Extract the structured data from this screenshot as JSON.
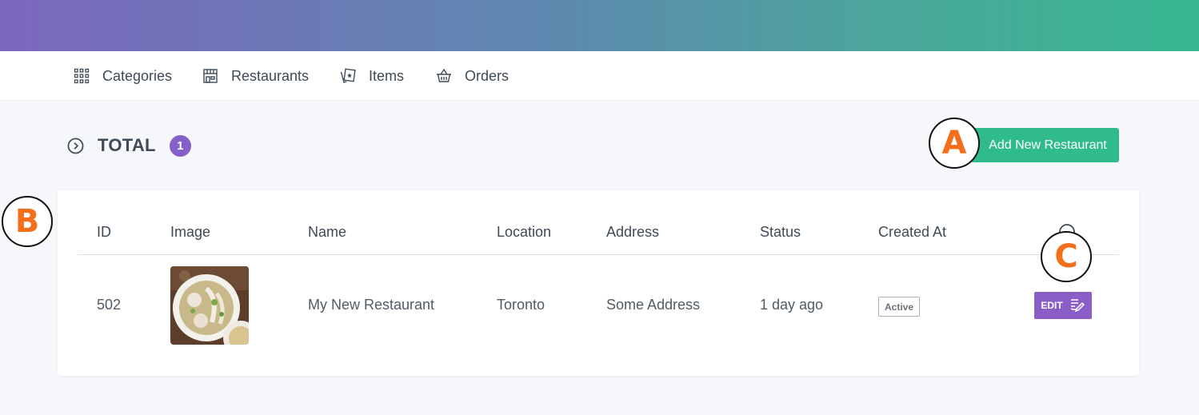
{
  "nav": {
    "items": [
      {
        "label": "Categories",
        "icon": "grid-icon"
      },
      {
        "label": "Restaurants",
        "icon": "store-icon"
      },
      {
        "label": "Items",
        "icon": "items-icon"
      },
      {
        "label": "Orders",
        "icon": "basket-icon"
      }
    ]
  },
  "summary": {
    "total_label": "TOTAL",
    "total_count": "1",
    "add_button_label": "Add New Restaurant"
  },
  "markers": {
    "a": "A",
    "b": "B",
    "c": "C"
  },
  "table": {
    "columns": [
      "ID",
      "Image",
      "Name",
      "Location",
      "Address",
      "Status",
      "Created At"
    ],
    "rows": [
      {
        "id": "502",
        "name": "My New Restaurant",
        "location": "Toronto",
        "address": "Some Address",
        "created_at": "1 day ago",
        "status": "Active",
        "edit_label": "EDIT"
      }
    ]
  },
  "colors": {
    "accent_purple": "#8560c8",
    "accent_green": "#2fbb8a",
    "marker_orange": "#f36f1b"
  }
}
